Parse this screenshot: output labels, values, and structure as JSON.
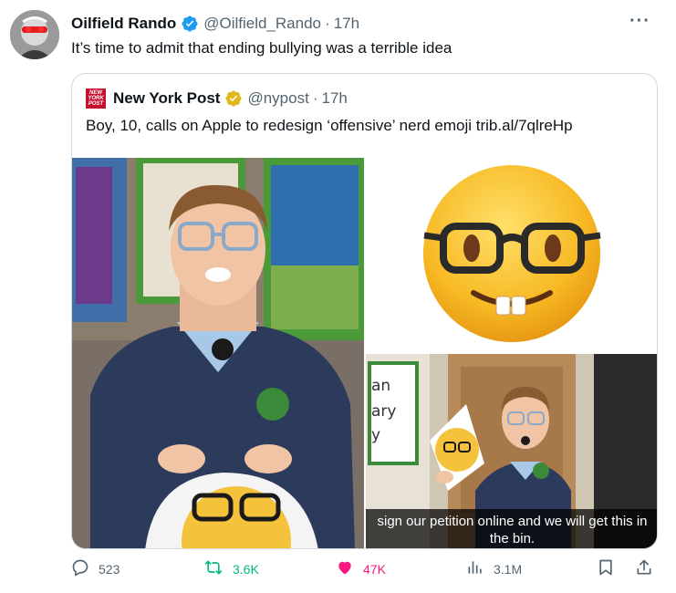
{
  "author": {
    "name": "Oilfield Rando",
    "handle": "@Oilfield_Rando",
    "separator": "·",
    "time": "17h"
  },
  "tweet": {
    "text": "It’s time to admit that ending bullying was a terrible idea"
  },
  "quoted": {
    "name": "New York Post",
    "handle": "@nypost",
    "separator": "·",
    "time": "17h",
    "text": "Boy, 10, calls on Apple to redesign ‘offensive’ nerd emoji trib.al/7qlreHp",
    "logo_text": "NEW YORK POST",
    "video_caption": "sign our petition online and we will get this in the bin.",
    "wall_letters": "an\nary\ny"
  },
  "actions": {
    "replies": "523",
    "reposts": "3.6K",
    "likes": "47K",
    "views": "3.1M"
  },
  "colors": {
    "verified_blue": "#1d9bf0",
    "verified_gold": "#e2b719",
    "repost_green": "#00ba7c",
    "like_pink": "#f91880",
    "nypost_red": "#c8102e"
  },
  "icons": [
    "more-icon",
    "verified-badge-icon",
    "gold-badge-icon",
    "reply-icon",
    "repost-icon",
    "like-icon",
    "views-icon",
    "bookmark-icon",
    "share-icon"
  ]
}
